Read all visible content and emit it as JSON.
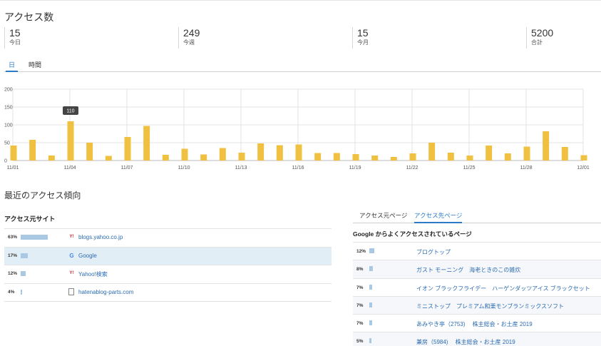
{
  "title": "アクセス数",
  "stats": [
    {
      "value": "15",
      "label": "今日"
    },
    {
      "value": "249",
      "label": "今週"
    },
    {
      "value": "15",
      "label": "今月"
    },
    {
      "value": "5200",
      "label": "合計"
    }
  ],
  "view_tabs": [
    {
      "label": "日",
      "active": true
    },
    {
      "label": "時間",
      "active": false
    }
  ],
  "chart_data": {
    "type": "bar",
    "categories": [
      "11/01",
      "11/02",
      "11/03",
      "11/04",
      "11/05",
      "11/06",
      "11/07",
      "11/08",
      "11/09",
      "11/10",
      "11/11",
      "11/12",
      "11/13",
      "11/14",
      "11/15",
      "11/16",
      "11/17",
      "11/18",
      "11/19",
      "11/20",
      "11/21",
      "11/22",
      "11/23",
      "11/24",
      "11/25",
      "11/26",
      "11/27",
      "11/28",
      "11/29",
      "11/30",
      "12/01"
    ],
    "tick_labels": [
      "11/01",
      "11/04",
      "11/07",
      "11/10",
      "11/13",
      "11/16",
      "11/19",
      "11/22",
      "11/25",
      "11/28",
      "12/01"
    ],
    "values": [
      42,
      58,
      14,
      110,
      50,
      13,
      66,
      97,
      16,
      33,
      17,
      35,
      22,
      48,
      43,
      45,
      21,
      21,
      18,
      14,
      10,
      20,
      50,
      22,
      14,
      42,
      20,
      39,
      82,
      38,
      15
    ],
    "ylim": [
      0,
      200
    ],
    "yticks": [
      0,
      50,
      100,
      150,
      200
    ],
    "grid": true,
    "bar_color": "#f0c040",
    "tooltip": {
      "category": "11/04",
      "value": "110"
    }
  },
  "trends_title": "最近のアクセス傾向",
  "sources": {
    "heading": "アクセス元サイト",
    "rows": [
      {
        "pct": "63%",
        "ratio": 0.63,
        "icon": "yahoo-icon",
        "label": "blogs.yahoo.co.jp",
        "highlighted": false
      },
      {
        "pct": "17%",
        "ratio": 0.17,
        "icon": "google-icon",
        "label": "Google",
        "highlighted": true
      },
      {
        "pct": "12%",
        "ratio": 0.12,
        "icon": "yahoo-icon",
        "label": "Yahoo!検索",
        "highlighted": false
      },
      {
        "pct": "4%",
        "ratio": 0.04,
        "icon": "document-icon",
        "label": "hatenablog-parts.com",
        "highlighted": false
      }
    ]
  },
  "page_tabs": [
    {
      "label": "アクセス元ページ",
      "active": false
    },
    {
      "label": "アクセス先ページ",
      "active": true
    }
  ],
  "pages": {
    "heading": "Google からよくアクセスされているページ",
    "rows": [
      {
        "pct": "12%",
        "ratio": 0.12,
        "label": "ブログトップ"
      },
      {
        "pct": "8%",
        "ratio": 0.08,
        "label": "ガスト モーニング　海老ときのこの雑炊"
      },
      {
        "pct": "7%",
        "ratio": 0.07,
        "label": "イオン ブラックフライデー　ハーゲンダッツアイス ブラックセット"
      },
      {
        "pct": "7%",
        "ratio": 0.07,
        "label": "ミニストップ　プレミアム和栗モンブランミックスソフト"
      },
      {
        "pct": "7%",
        "ratio": 0.07,
        "label": "あみやき亭（2753)　 株主総会・お土産 2019"
      },
      {
        "pct": "5%",
        "ratio": 0.05,
        "label": "兼房（5984)　 株主総会・お土産 2019"
      }
    ]
  }
}
